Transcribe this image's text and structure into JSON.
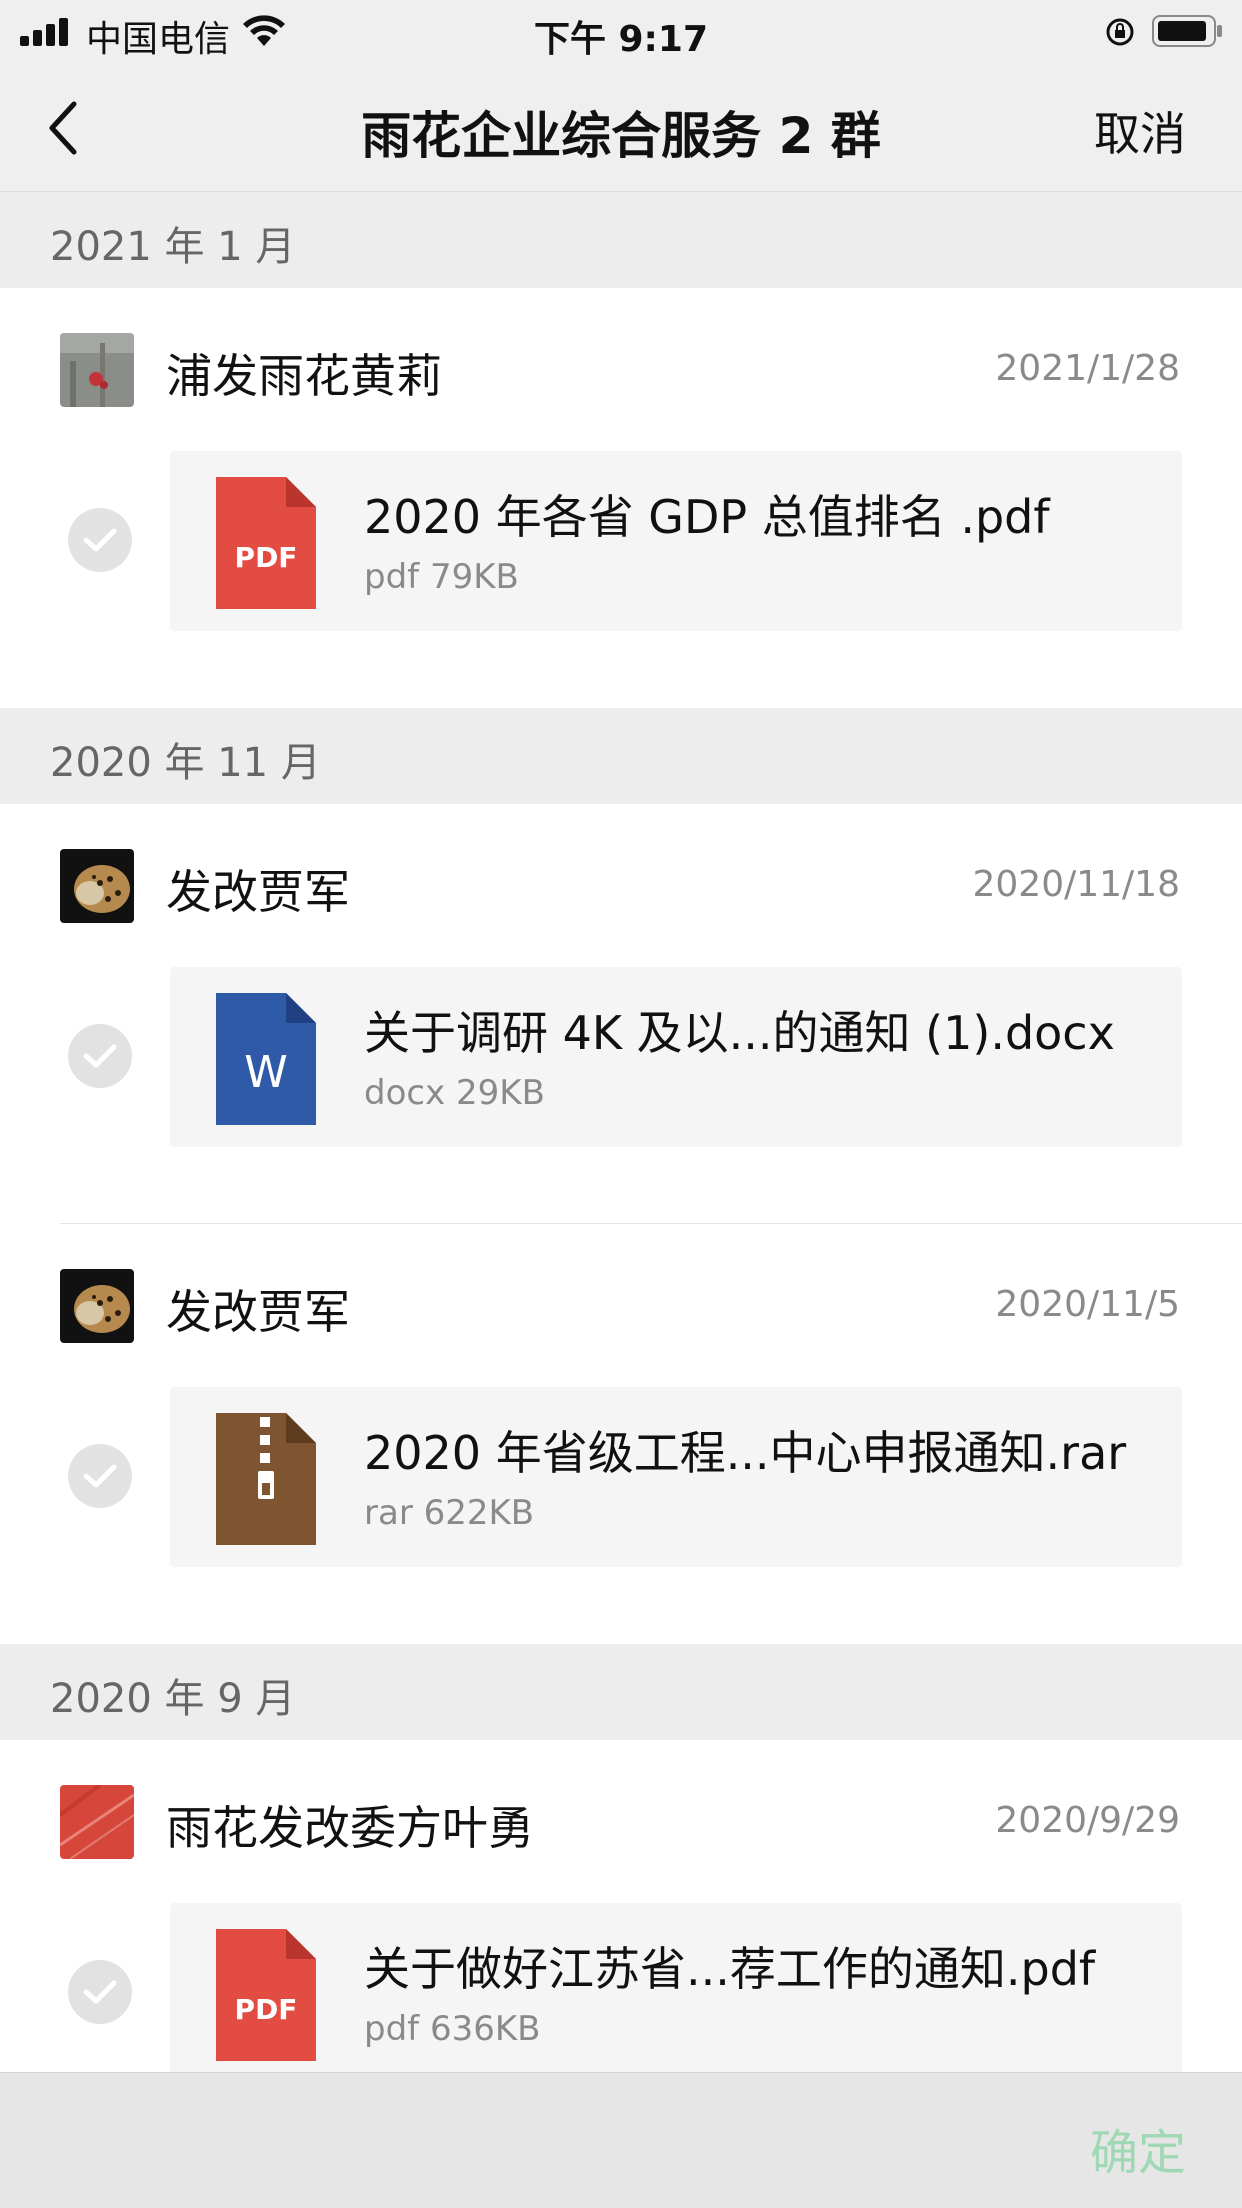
{
  "status_bar": {
    "carrier": "中国电信",
    "time": "下午 9:17"
  },
  "nav": {
    "title": "雨花企业综合服务 2 群",
    "cancel": "取消",
    "back_icon": "chevron-left-icon"
  },
  "groups": [
    {
      "month": "2021 年 1 月",
      "entries": [
        {
          "sender": "浦发雨花黄莉",
          "date": "2021/1/28",
          "file_name": "2020 年各省 GDP 总值排名 .pdf",
          "file_meta": "pdf 79KB",
          "file_type": "pdf",
          "file_icon_label": "PDF"
        }
      ]
    },
    {
      "month": "2020 年 11 月",
      "entries": [
        {
          "sender": "发改贾军",
          "date": "2020/11/18",
          "file_name": "关于调研 4K 及以...的通知 (1).docx",
          "file_meta": "docx 29KB",
          "file_type": "docx",
          "file_icon_label": "W"
        },
        {
          "sender": "发改贾军",
          "date": "2020/11/5",
          "file_name": "2020 年省级工程...中心申报通知.rar",
          "file_meta": "rar 622KB",
          "file_type": "rar",
          "file_icon_label": ""
        }
      ]
    },
    {
      "month": "2020 年 9 月",
      "entries": [
        {
          "sender": "雨花发改委方叶勇",
          "date": "2020/9/29",
          "file_name": "关于做好江苏省...荐工作的通知.pdf",
          "file_meta": "pdf 636KB",
          "file_type": "pdf",
          "file_icon_label": "PDF"
        }
      ]
    }
  ],
  "footer": {
    "confirm": "确定"
  },
  "colors": {
    "pdf": "#e24c43",
    "docx": "#2f5aa8",
    "rar": "#7f5431",
    "confirm_disabled": "#9fd9b4"
  }
}
